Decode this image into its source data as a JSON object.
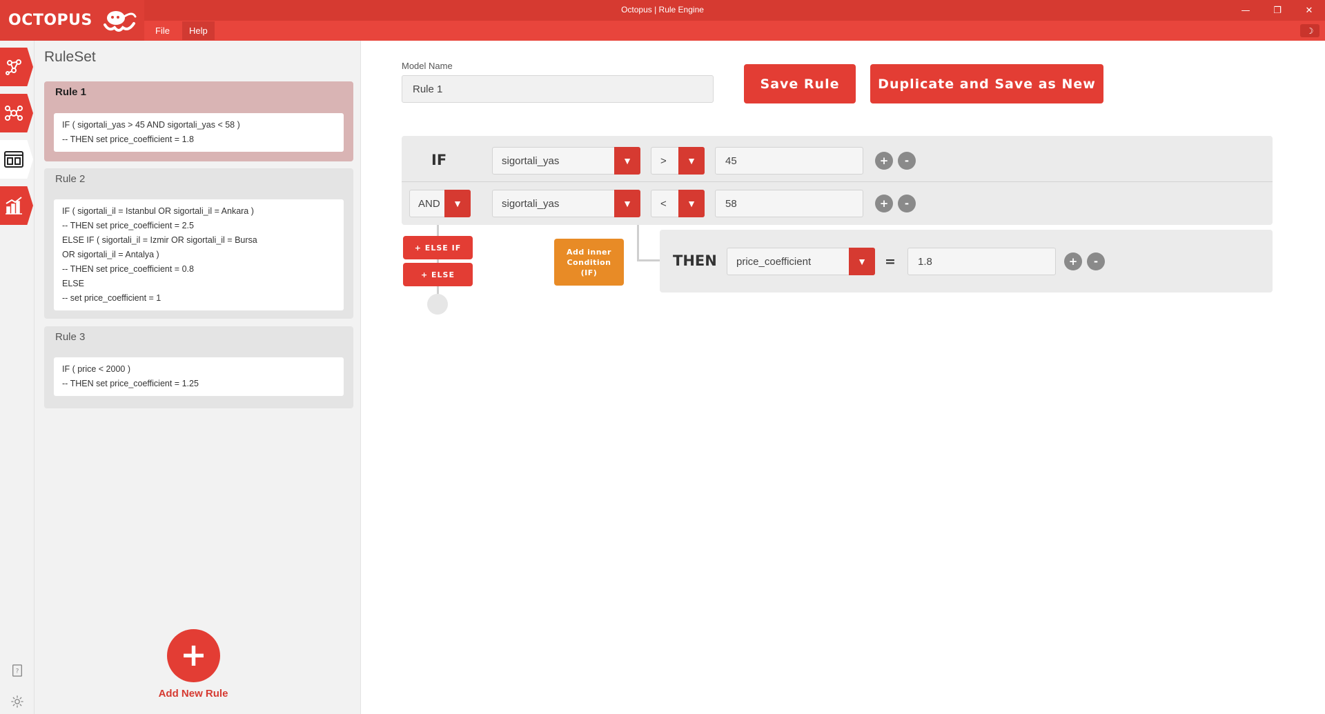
{
  "app": {
    "logo_text": "OCTOPUS",
    "window_title": "Octopus | Rule Engine",
    "menu": [
      "File",
      "Help"
    ],
    "controls": {
      "minimize": "—",
      "restore": "❐",
      "close": "✕",
      "theme": "☽"
    }
  },
  "ruleset": {
    "title": "RuleSet",
    "rules": [
      {
        "name": "Rule 1",
        "lines": [
          "IF ( sigortali_yas > 45 AND sigortali_yas < 58 )",
          "-- THEN set price_coefficient = 1.8"
        ]
      },
      {
        "name": "Rule 2",
        "lines": [
          "IF ( sigortali_il = Istanbul OR sigortali_il = Ankara )",
          "-- THEN set price_coefficient = 2.5",
          "ELSE IF ( sigortali_il = Izmir OR sigortali_il = Bursa",
          "OR sigortali_il = Antalya )",
          "-- THEN set price_coefficient = 0.8",
          "ELSE",
          "-- set price_coefficient = 1"
        ]
      },
      {
        "name": "Rule 3",
        "lines": [
          "IF ( price < 2000 )",
          "-- THEN set price_coefficient = 1.25"
        ]
      }
    ],
    "add_button_symbol": "+",
    "add_label": "Add New Rule"
  },
  "editor": {
    "model_label": "Model Name",
    "model_value": "Rule 1",
    "save_label": "Save Rule",
    "duplicate_label": "Duplicate and Save as New",
    "if_keyword": "IF",
    "conditions": [
      {
        "field": "sigortali_yas",
        "operator": ">",
        "value": "45"
      },
      {
        "connector": "AND",
        "field": "sigortali_yas",
        "operator": "<",
        "value": "58"
      }
    ],
    "else_if_label": "+ ELSE IF",
    "else_label": "+ ELSE",
    "inner_condition_lines": [
      "Add inner",
      "Condition",
      "(IF)"
    ],
    "then_keyword": "THEN",
    "then_field": "price_coefficient",
    "then_equals": "=",
    "then_value": "1.8",
    "plus": "+",
    "minus": "-",
    "dropdown_arrow": "▼"
  },
  "colors": {
    "brand_red": "#e33d34",
    "title_bar": "#d63a31",
    "selected_rule": "#d9b4b4",
    "orange": "#e88b26"
  }
}
